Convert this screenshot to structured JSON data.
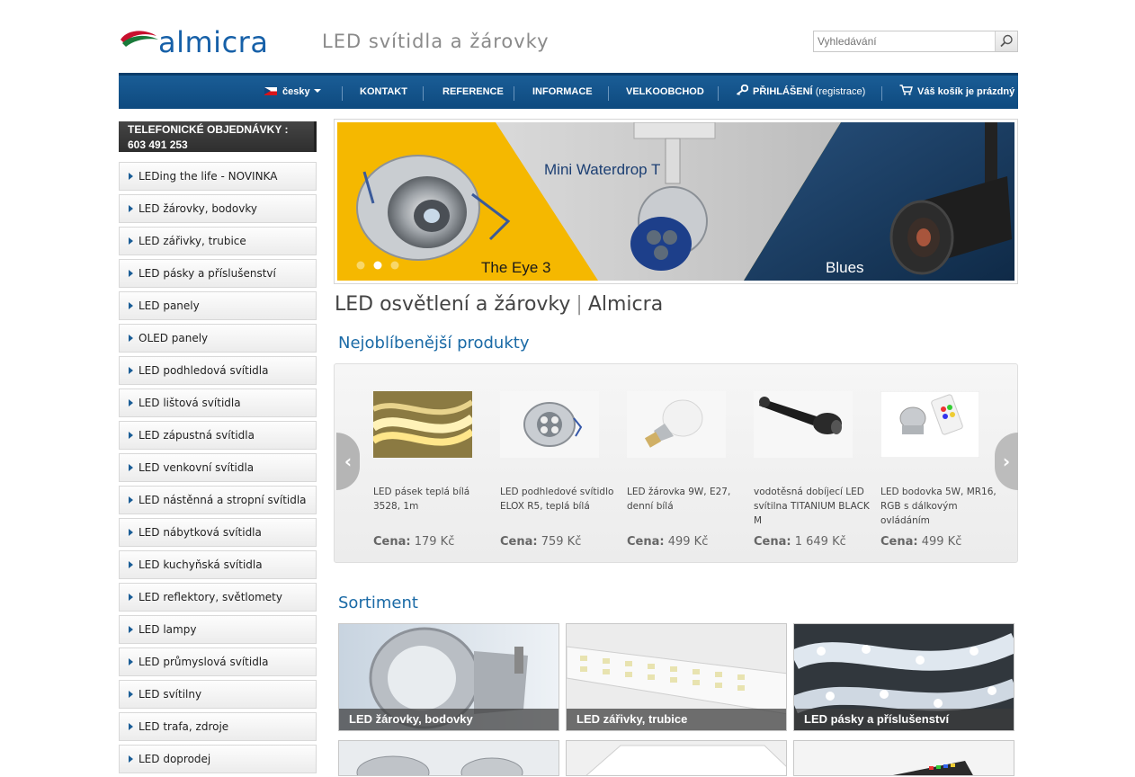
{
  "header": {
    "logo_text": "almicra",
    "tagline": "LED svítidla a žárovky",
    "search_placeholder": "Vyhledávání"
  },
  "nav": {
    "language": "česky",
    "items": [
      "KONTAKT",
      "REFERENCE",
      "INFORMACE",
      "VELKOOBCHOD"
    ],
    "login": "PŘIHLÁŠENÍ",
    "register": "(registrace)",
    "cart": "Váš košík je prázdný"
  },
  "sidebar": {
    "phone_title": "TELEFONICKÉ OBJEDNÁVKY :",
    "phone_number": "603 491 253",
    "categories": [
      "LEDing the life - NOVINKA",
      "LED žárovky, bodovky",
      "LED zářivky, trubice",
      "LED pásky a příslušenství",
      "LED panely",
      "OLED panely",
      "LED podhledová svítidla",
      "LED lištová svítidla",
      "LED zápustná svítidla",
      "LED venkovní svítidla",
      "LED nástěnná a stropní svítidla",
      "LED nábytková svítidla",
      "LED kuchyňská svítidla",
      "LED reflektory, světlomety",
      "LED lampy",
      "LED průmyslová svítidla",
      "LED svítilny",
      "LED trafa, zdroje",
      "LED doprodej"
    ]
  },
  "banner": {
    "labels": [
      "The Eye 3",
      "Mini Waterdrop T",
      "Blues"
    ],
    "active_dot": 2,
    "dot_count": 3
  },
  "main": {
    "title": "LED osvětlení a žárovky",
    "title_brand": "Almicra",
    "popular_heading": "Nejoblíbenější produkty",
    "price_label": "Cena:",
    "products": [
      {
        "name": "LED pásek teplá bílá 3528, 1m",
        "price": "179 Kč"
      },
      {
        "name": "LED podhledové svítidlo ELOX R5, teplá bílá",
        "price": "759 Kč"
      },
      {
        "name": "LED žárovka 9W, E27, denní bílá",
        "price": "499 Kč"
      },
      {
        "name": "vodotěsná dobíjecí LED svítilna TITANIUM BLACK M",
        "price": "1 649 Kč"
      },
      {
        "name": "LED bodovka 5W, MR16, RGB s dálkovým ovládáním",
        "price": "499 Kč"
      }
    ],
    "assortment_heading": "Sortiment",
    "assortment": [
      "LED žárovky, bodovky",
      "LED zářivky, trubice",
      "LED pásky a příslušenství"
    ]
  },
  "colors": {
    "nav_blue": "#155993",
    "heading_blue": "#1a6aa6",
    "banner_yellow": "#f5b800",
    "banner_navy": "#1c3c62"
  }
}
